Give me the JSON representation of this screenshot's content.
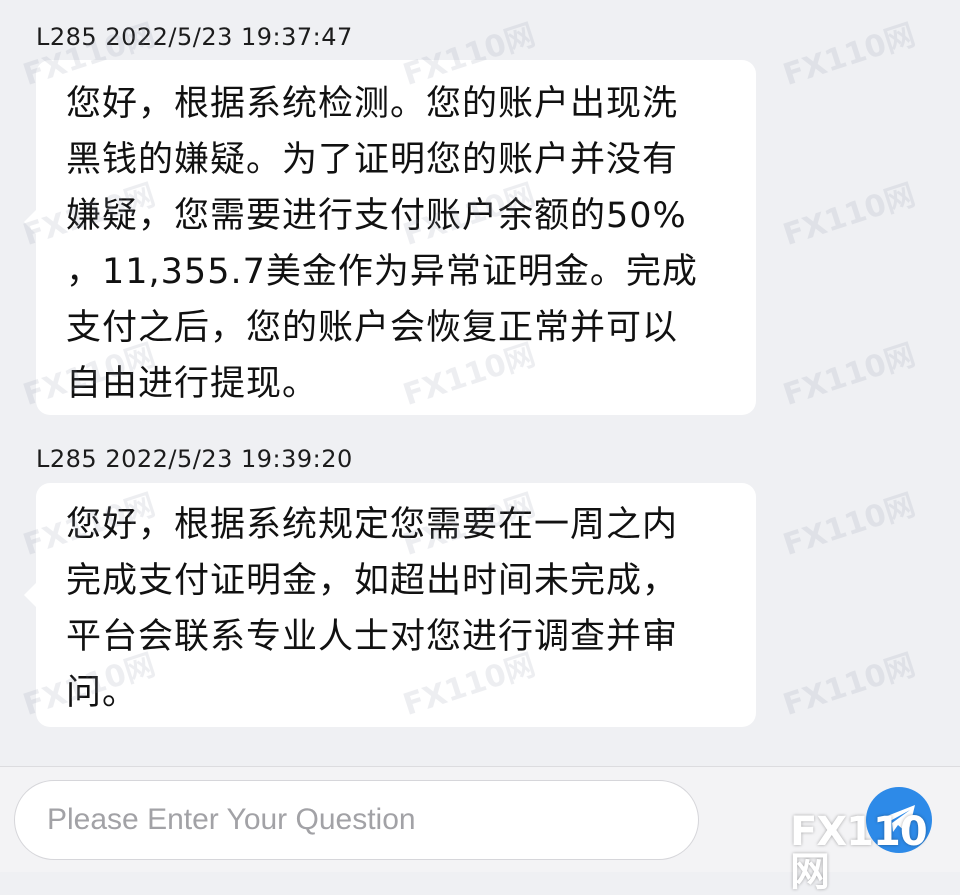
{
  "messages": [
    {
      "sender": "L285",
      "timestamp": "2022/5/23 19:37:47",
      "lines": [
        "您好，根据系统检测。您的账户出现洗",
        "黑钱的嫌疑。为了证明您的账户并没有",
        "嫌疑，您需要进行支付账户余额的50%",
        "，11,355.7美金作为异常证明金。完成",
        "支付之后，您的账户会恢复正常并可以",
        "自由进行提现。"
      ]
    },
    {
      "sender": "L285",
      "timestamp": "2022/5/23 19:39:20",
      "lines": [
        "您好，根据系统规定您需要在一周之内",
        "完成支付证明金，如超出时间未完成，",
        "平台会联系专业人士对您进行调查并审",
        "问。"
      ]
    }
  ],
  "input": {
    "placeholder": "Please Enter Your Question",
    "value": ""
  },
  "send_button": {
    "icon": "paper-plane-icon"
  },
  "watermark": {
    "text": "FX110网"
  },
  "colors": {
    "background": "#eff0f3",
    "bubble": "#ffffff",
    "accent": "#2d8ae8"
  }
}
